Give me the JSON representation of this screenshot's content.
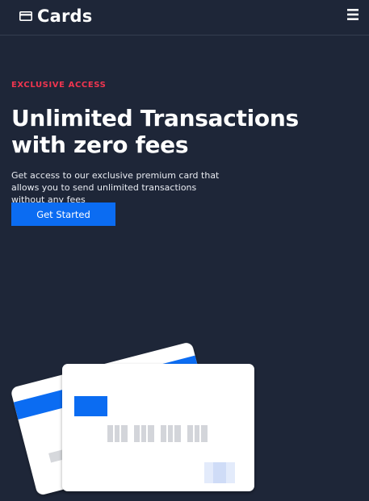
{
  "header": {
    "brand_name": "Cards",
    "brand_icon": "credit-card-icon",
    "menu_icon": "hamburger-menu-icon"
  },
  "hero": {
    "eyebrow": "EXCLUSIVE ACCESS",
    "headline": "Unlimited Transactions with zero fees",
    "description": "Get access to our exclusive premium card that allows you to send unlimited transactions without any fees",
    "cta_label": "Get Started"
  },
  "colors": {
    "background": "#1e2638",
    "accent": "#0b6cf2",
    "eyebrow": "#f0354f",
    "card_surface": "#ffffff"
  }
}
